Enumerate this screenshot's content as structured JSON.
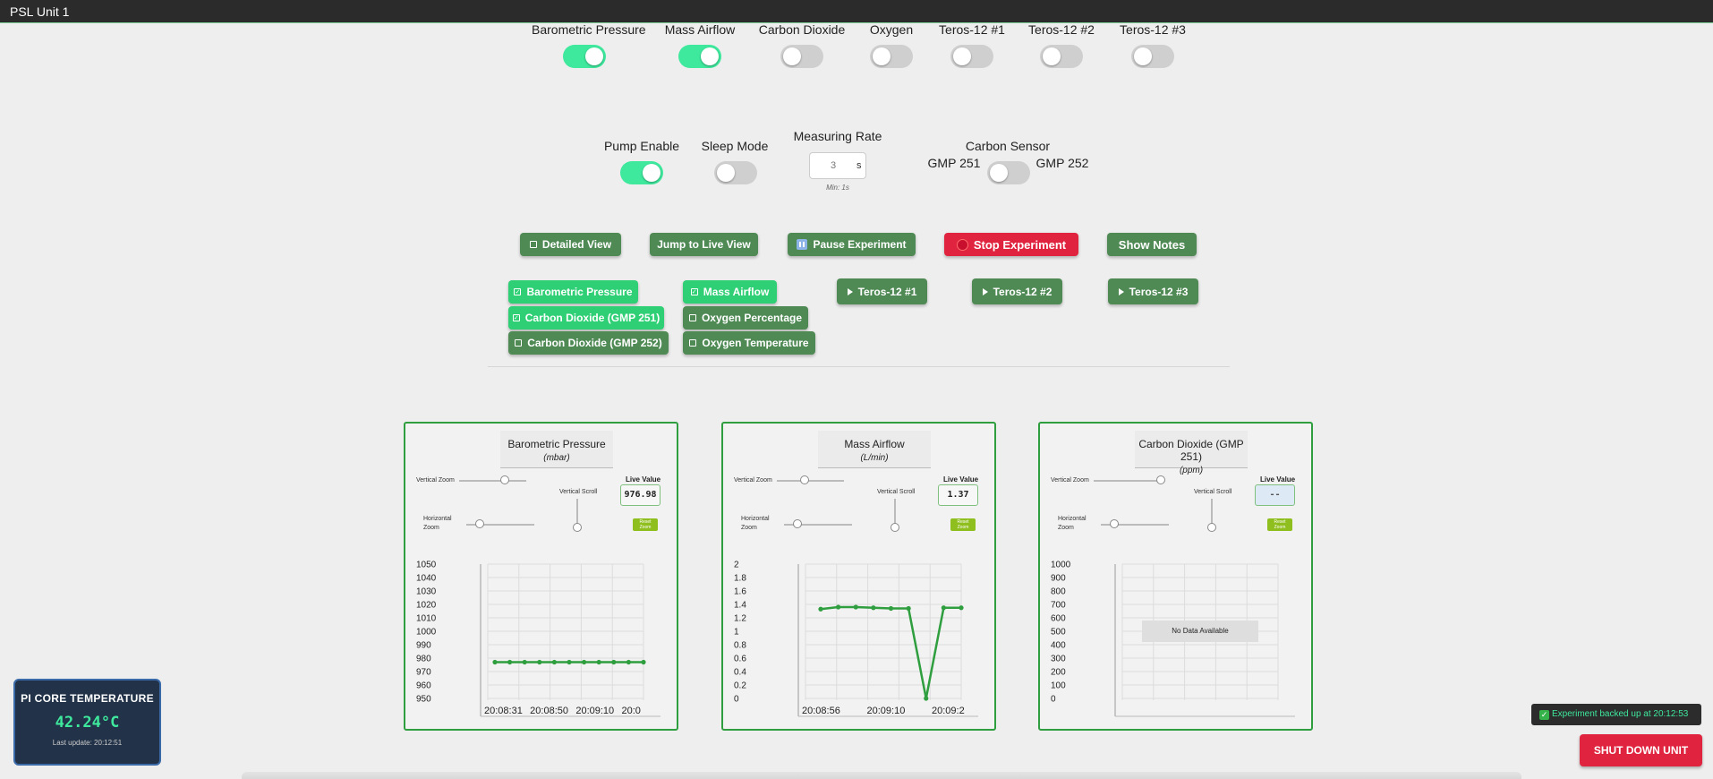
{
  "window": {
    "title": "PSL Unit 1"
  },
  "sensors": [
    {
      "label": "Barometric Pressure",
      "on": true
    },
    {
      "label": "Mass Airflow",
      "on": true
    },
    {
      "label": "Carbon Dioxide",
      "on": false
    },
    {
      "label": "Oxygen",
      "on": false
    },
    {
      "label": "Teros-12 #1",
      "on": false
    },
    {
      "label": "Teros-12 #2",
      "on": false
    },
    {
      "label": "Teros-12 #3",
      "on": false
    }
  ],
  "controls": {
    "pump_label": "Pump Enable",
    "pump_on": true,
    "sleep_label": "Sleep Mode",
    "sleep_on": false,
    "rate_label": "Measuring Rate",
    "rate_value": "3",
    "rate_unit": "s",
    "rate_min": "Min: 1s",
    "carbon_label": "Carbon Sensor",
    "carbon_left": "GMP 251",
    "carbon_right": "GMP 252",
    "carbon_on": false
  },
  "actions": {
    "detailed": "Detailed View",
    "jump": "Jump to Live View",
    "pause": "Pause Experiment",
    "stop": "Stop Experiment",
    "notes": "Show Notes"
  },
  "series_buttons": {
    "baro": "Barometric Pressure",
    "mass": "Mass Airflow",
    "co2_251": "Carbon Dioxide (GMP 251)",
    "o2_pct": "Oxygen Percentage",
    "co2_252": "Carbon Dioxide (GMP 252)",
    "o2_temp": "Oxygen Temperature",
    "teros1": "Teros-12 #1",
    "teros2": "Teros-12 #2",
    "teros3": "Teros-12 #3"
  },
  "panel_labels": {
    "vertical_zoom": "Vertical Zoom",
    "vertical_scroll": "Vertical Scroll",
    "horizontal_zoom_1": "Horizontal",
    "horizontal_zoom_2": "Zoom",
    "live_value": "Live Value",
    "reset_1": "Reset",
    "reset_2": "Zoom",
    "no_data": "No Data Available"
  },
  "panels": [
    {
      "title": "Barometric Pressure",
      "unit": "(mbar)",
      "live": "976.98"
    },
    {
      "title": "Mass Airflow",
      "unit": "(L/min)",
      "live": "1.37"
    },
    {
      "title": "Carbon Dioxide (GMP 251)",
      "unit": "(ppm)",
      "live": "--"
    }
  ],
  "chart_data": [
    {
      "type": "line",
      "title": "Barometric Pressure",
      "ylabel": "(mbar)",
      "yticks": [
        "1050",
        "1040",
        "1030",
        "1020",
        "1010",
        "1000",
        "990",
        "980",
        "970",
        "960",
        "950"
      ],
      "ylim": [
        950,
        1050
      ],
      "xtick_labels": [
        "20:08:31",
        "20:08:50",
        "20:09:10",
        "20:0"
      ],
      "values": [
        977,
        977,
        977,
        977,
        977,
        977,
        977,
        977,
        977,
        977,
        977
      ],
      "color": "#2e9e3e",
      "grid": true
    },
    {
      "type": "line",
      "title": "Mass Airflow",
      "ylabel": "(L/min)",
      "yticks": [
        "2",
        "1.8",
        "1.6",
        "1.4",
        "1.2",
        "1",
        "0.8",
        "0.6",
        "0.4",
        "0.2",
        "0"
      ],
      "ylim": [
        0,
        2
      ],
      "xtick_labels": [
        "20:08:56",
        "20:09:10",
        "20:09:2"
      ],
      "values": [
        1.33,
        1.36,
        1.36,
        1.35,
        1.34,
        1.34,
        0.0,
        1.35,
        1.35
      ],
      "color": "#2e9e3e",
      "grid": true
    },
    {
      "type": "line",
      "title": "Carbon Dioxide (GMP 251)",
      "ylabel": "(ppm)",
      "yticks": [
        "1000",
        "900",
        "800",
        "700",
        "600",
        "500",
        "400",
        "300",
        "200",
        "100",
        "0"
      ],
      "ylim": [
        0,
        1000
      ],
      "xtick_labels": [],
      "values": [],
      "grid": true
    }
  ],
  "status": {
    "temp_title": "PI CORE TEMPERATURE",
    "temp_value": "42.24°C",
    "temp_update": "Last update: 20:12:51",
    "toast": "Experiment backed up at 20:12:53",
    "shutdown": "SHUT DOWN UNIT"
  },
  "colors": {
    "accent": "#3ee89d",
    "button": "#4f8a55",
    "button_bright": "#2fcf75",
    "danger": "#e0243f",
    "chart_border": "#2e9e3e"
  }
}
